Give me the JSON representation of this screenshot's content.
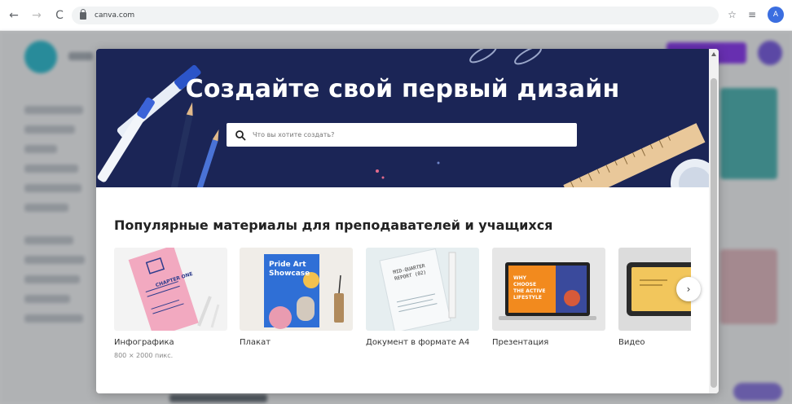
{
  "browser": {
    "url": "canva.com",
    "profile_initial": "A",
    "back_icon": "←",
    "forward_icon": "→",
    "reload_icon": "C",
    "star_icon": "☆",
    "reading_list_icon": "≡"
  },
  "modal": {
    "hero_title": "Создайте свой первый дизайн",
    "search_placeholder": "Что вы хотите создать?",
    "section_title": "Популярные материалы для преподавателей и учащихся",
    "next_icon": "›",
    "cards": [
      {
        "label": "Инфографика",
        "sub": "800 × 2000 пикс."
      },
      {
        "label": "Плакат"
      },
      {
        "label": "Документ в формате A4"
      },
      {
        "label": "Презентация"
      },
      {
        "label": "Видео"
      }
    ],
    "thumbs": {
      "infographic_text": "CHAPTER ONE",
      "poster_text_1": "Pride Art",
      "poster_text_2": "Showcase",
      "doc_text": "MID-QUARTER REPORT (02)",
      "pres_text_1": "WHY",
      "pres_text_2": "CHOOSE",
      "pres_text_3": "THE ACTIVE",
      "pres_text_4": "LIFESTYLE"
    }
  }
}
